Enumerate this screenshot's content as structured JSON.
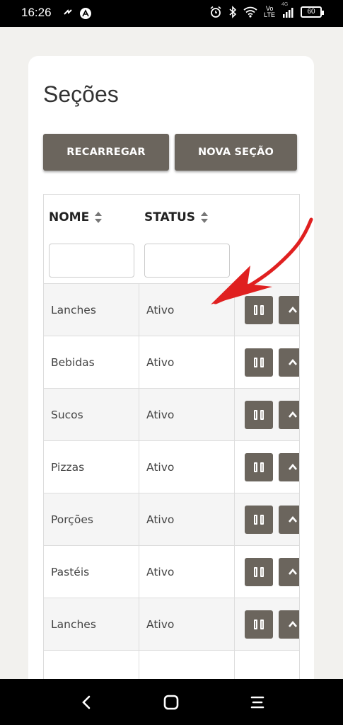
{
  "status_bar": {
    "time": "16:26",
    "battery": "60",
    "volte_top": "Vo",
    "volte_bottom": "LTE",
    "net": "4G"
  },
  "page": {
    "title": "Seções",
    "buttons": {
      "reload": "RECARREGAR",
      "new_section": "NOVA SEÇÃO"
    }
  },
  "table": {
    "columns": [
      "NOME",
      "STATUS"
    ],
    "rows": [
      {
        "nome": "Lanches",
        "status": "Ativo"
      },
      {
        "nome": "Bebidas",
        "status": "Ativo"
      },
      {
        "nome": "Sucos",
        "status": "Ativo"
      },
      {
        "nome": "Pizzas",
        "status": "Ativo"
      },
      {
        "nome": "Porções",
        "status": "Ativo"
      },
      {
        "nome": "Pastéis",
        "status": "Ativo"
      },
      {
        "nome": "Lanches",
        "status": "Ativo"
      },
      {
        "nome": "",
        "status": ""
      }
    ]
  },
  "colors": {
    "button": "#6b655d",
    "arrow": "#e02020",
    "background": "#f2f1ee"
  },
  "icons": [
    "pause-icon",
    "chevron-up-icon",
    "sort-icon",
    "back-icon",
    "home-icon",
    "recents-icon"
  ]
}
